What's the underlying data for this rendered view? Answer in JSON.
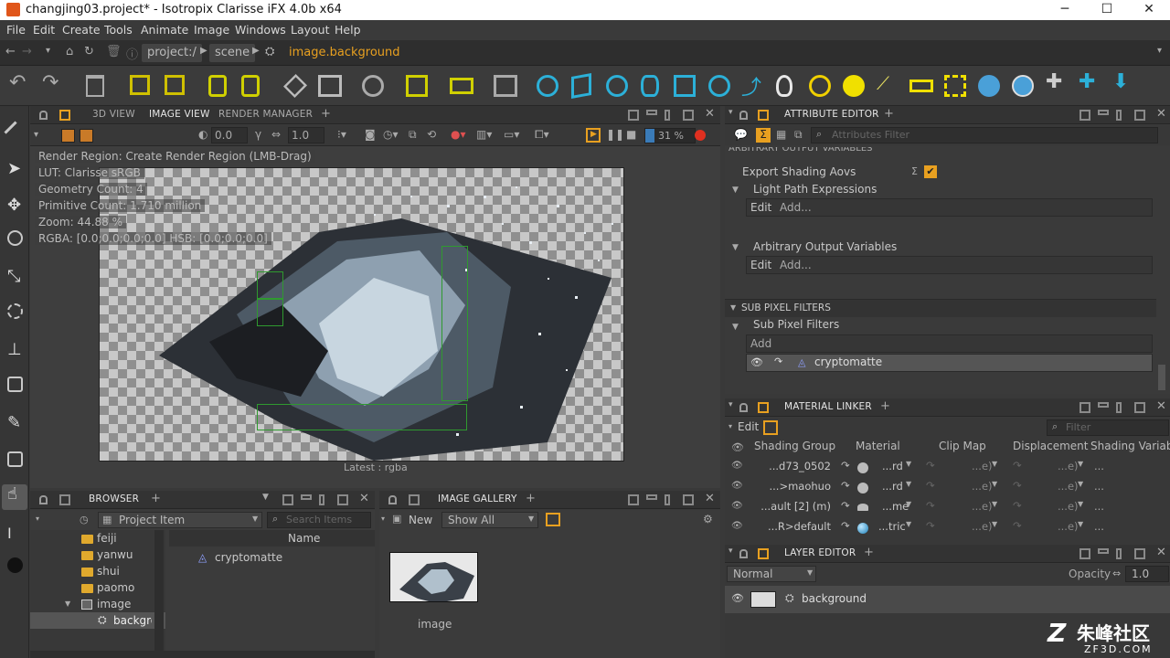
{
  "window": {
    "title": "changjing03.project* - Isotropix Clarisse iFX 4.0b x64"
  },
  "menu": [
    "File",
    "Edit",
    "Create",
    "Tools",
    "Animate",
    "Image",
    "Windows",
    "Layout",
    "Help"
  ],
  "address": {
    "crumbs": [
      "project:/",
      "scene",
      "image.background"
    ]
  },
  "viewport_tabs": {
    "tabs": [
      "3D VIEW",
      "IMAGE VIEW",
      "RENDER MANAGER"
    ],
    "active": "IMAGE VIEW"
  },
  "viewport_bar": {
    "exposure": "0.0",
    "gamma": "1.0",
    "zoom": "31 %"
  },
  "viewport_info": {
    "lines": [
      "Render Region: Create Render Region (LMB-Drag)",
      "LUT: Clarisse sRGB",
      "Geometry Count: 4",
      "Primitive Count: 1.710 million",
      "Zoom: 44.88 %",
      "RGBA: [0.0;0.0;0.0;0.0] HSB: [0.0;0.0;0.0]"
    ],
    "status": "Latest : rgba"
  },
  "attribute_editor": {
    "tab": "ATTRIBUTE EDITOR",
    "filter_placeholder": "Attributes Filter",
    "section_cut": "ARBITRARY OUTPUT VARIABLES",
    "export_aovs": "Export Shading Aovs",
    "light_path": "Light Path Expressions",
    "edit": "Edit",
    "add": "Add...",
    "aov": "Arbitrary Output Variables",
    "subpixel_section": "SUB PIXEL FILTERS",
    "subpixel": "Sub Pixel Filters",
    "add2": "Add",
    "item": "cryptomatte"
  },
  "material_linker": {
    "tab": "MATERIAL LINKER",
    "edit": "Edit",
    "filter_placeholder": "Filter",
    "columns": [
      "Shading Group",
      "Material",
      "Clip Map",
      "Displacement",
      "Shading Variable"
    ],
    "rows": [
      {
        "group": "...d73_0502",
        "material": "...rd",
        "clip": "...e)",
        "disp": "...e)"
      },
      {
        "group": "...>maohuo",
        "material": "...rd",
        "clip": "...e)",
        "disp": "...e)"
      },
      {
        "group": "...ault [2] (m)",
        "material": "...me",
        "clip": "...e)",
        "disp": "...e)"
      },
      {
        "group": "...R>default",
        "material": "...tric",
        "clip": "...e)",
        "disp": "...e)"
      }
    ],
    "ellipsis": "..."
  },
  "layer_editor": {
    "tab": "LAYER EDITOR",
    "blend": "Normal",
    "opacity_label": "Opacity",
    "opacity": "1.0",
    "layer": "background"
  },
  "browser": {
    "tab": "BROWSER",
    "type_select": "Project Item",
    "search_placeholder": "Search Items",
    "name_col": "Name",
    "tree": [
      "feiji",
      "yanwu",
      "shui",
      "paomo",
      "image",
      "backgro"
    ],
    "items": [
      "cryptomatte"
    ]
  },
  "gallery": {
    "tab": "IMAGE GALLERY",
    "new": "New",
    "show": "Show All",
    "thumb_label": "image"
  },
  "watermark": {
    "brand": "朱峰社区",
    "url": "ZF3D.COM"
  },
  "colors": {
    "accent": "#e8a020",
    "bg": "#393939",
    "selection": "#d9c000"
  }
}
